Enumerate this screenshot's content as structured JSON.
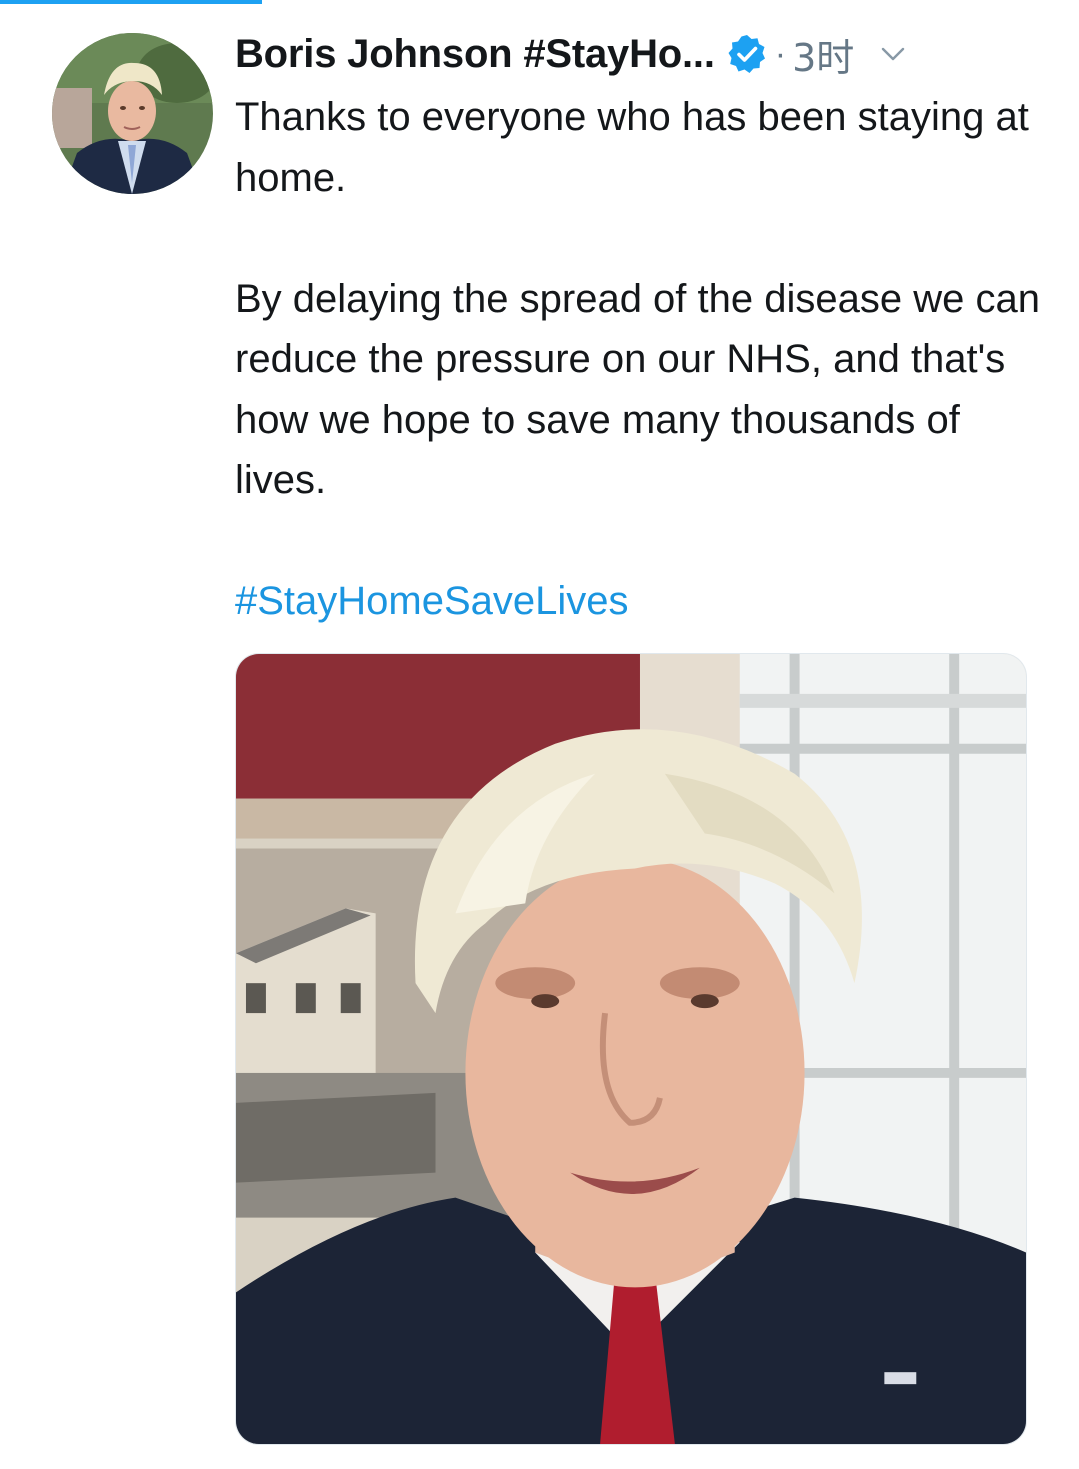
{
  "tweet": {
    "author": {
      "display_name": "Boris Johnson #StayHo...",
      "verified_icon": "verified-badge-icon",
      "avatar_icon": "profile-photo"
    },
    "separator": "·",
    "timestamp": "3时",
    "menu_icon": "chevron-down-icon",
    "text_paragraphs": [
      "Thanks to everyone who has been staying at home.",
      "By delaying the spread of the disease we can reduce the pressure on our NHS, and that's how we hope to save many thousands of lives."
    ],
    "hashtag": "#StayHomeSaveLives",
    "media": {
      "type": "video-thumbnail"
    }
  },
  "colors": {
    "link": "#1b95e0",
    "verified": "#1da1f2",
    "muted": "#657786",
    "text": "#14171a"
  }
}
